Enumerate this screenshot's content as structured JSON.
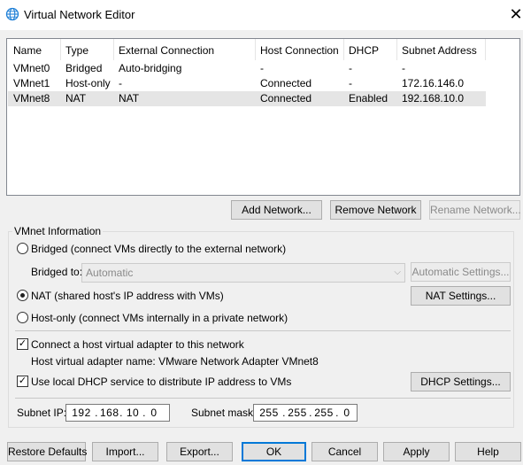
{
  "window": {
    "title": "Virtual Network Editor",
    "close_glyph": "✕"
  },
  "table": {
    "columns": [
      "Name",
      "Type",
      "External Connection",
      "Host Connection",
      "DHCP",
      "Subnet Address"
    ],
    "rows": [
      [
        "VMnet0",
        "Bridged",
        "Auto-bridging",
        "-",
        "-",
        "-"
      ],
      [
        "VMnet1",
        "Host-only",
        "-",
        "Connected",
        "-",
        "172.16.146.0"
      ],
      [
        "VMnet8",
        "NAT",
        "NAT",
        "Connected",
        "Enabled",
        "192.168.10.0"
      ]
    ],
    "selected_row": 2
  },
  "table_buttons": {
    "add": "Add Network...",
    "remove": "Remove Network",
    "rename": "Rename Network..."
  },
  "vmnet_info": {
    "group_title": "VMnet Information",
    "bridged_label": "Bridged (connect VMs directly to the external network)",
    "bridged_to_label": "Bridged to:",
    "bridged_to_value": "Automatic",
    "auto_settings": "Automatic Settings...",
    "nat_label": "NAT (shared host's IP address with VMs)",
    "nat_settings": "NAT Settings...",
    "hostonly_label": "Host-only (connect VMs internally in a private network)",
    "selected_mode": "nat",
    "connect_adapter_label": "Connect a host virtual adapter to this network",
    "connect_adapter_checked": true,
    "adapter_name_text": "Host virtual adapter name: VMware Network Adapter VMnet8",
    "dhcp_label": "Use local DHCP service to distribute IP address to VMs",
    "dhcp_checked": true,
    "dhcp_settings": "DHCP Settings...",
    "subnet_ip_label": "Subnet IP:",
    "subnet_ip": [
      "192",
      "168",
      "10",
      "0"
    ],
    "subnet_mask_label": "Subnet mask:",
    "subnet_mask": [
      "255",
      "255",
      "255",
      "0"
    ]
  },
  "footer_buttons": {
    "restore": "Restore Defaults",
    "import": "Import...",
    "export": "Export...",
    "ok": "OK",
    "cancel": "Cancel",
    "apply": "Apply",
    "help": "Help"
  },
  "colors": {
    "accent": "#0078d7",
    "icon": "#1e7fd6"
  },
  "icons": {
    "window": "globe-icon",
    "combo": "chevron-down-icon"
  }
}
